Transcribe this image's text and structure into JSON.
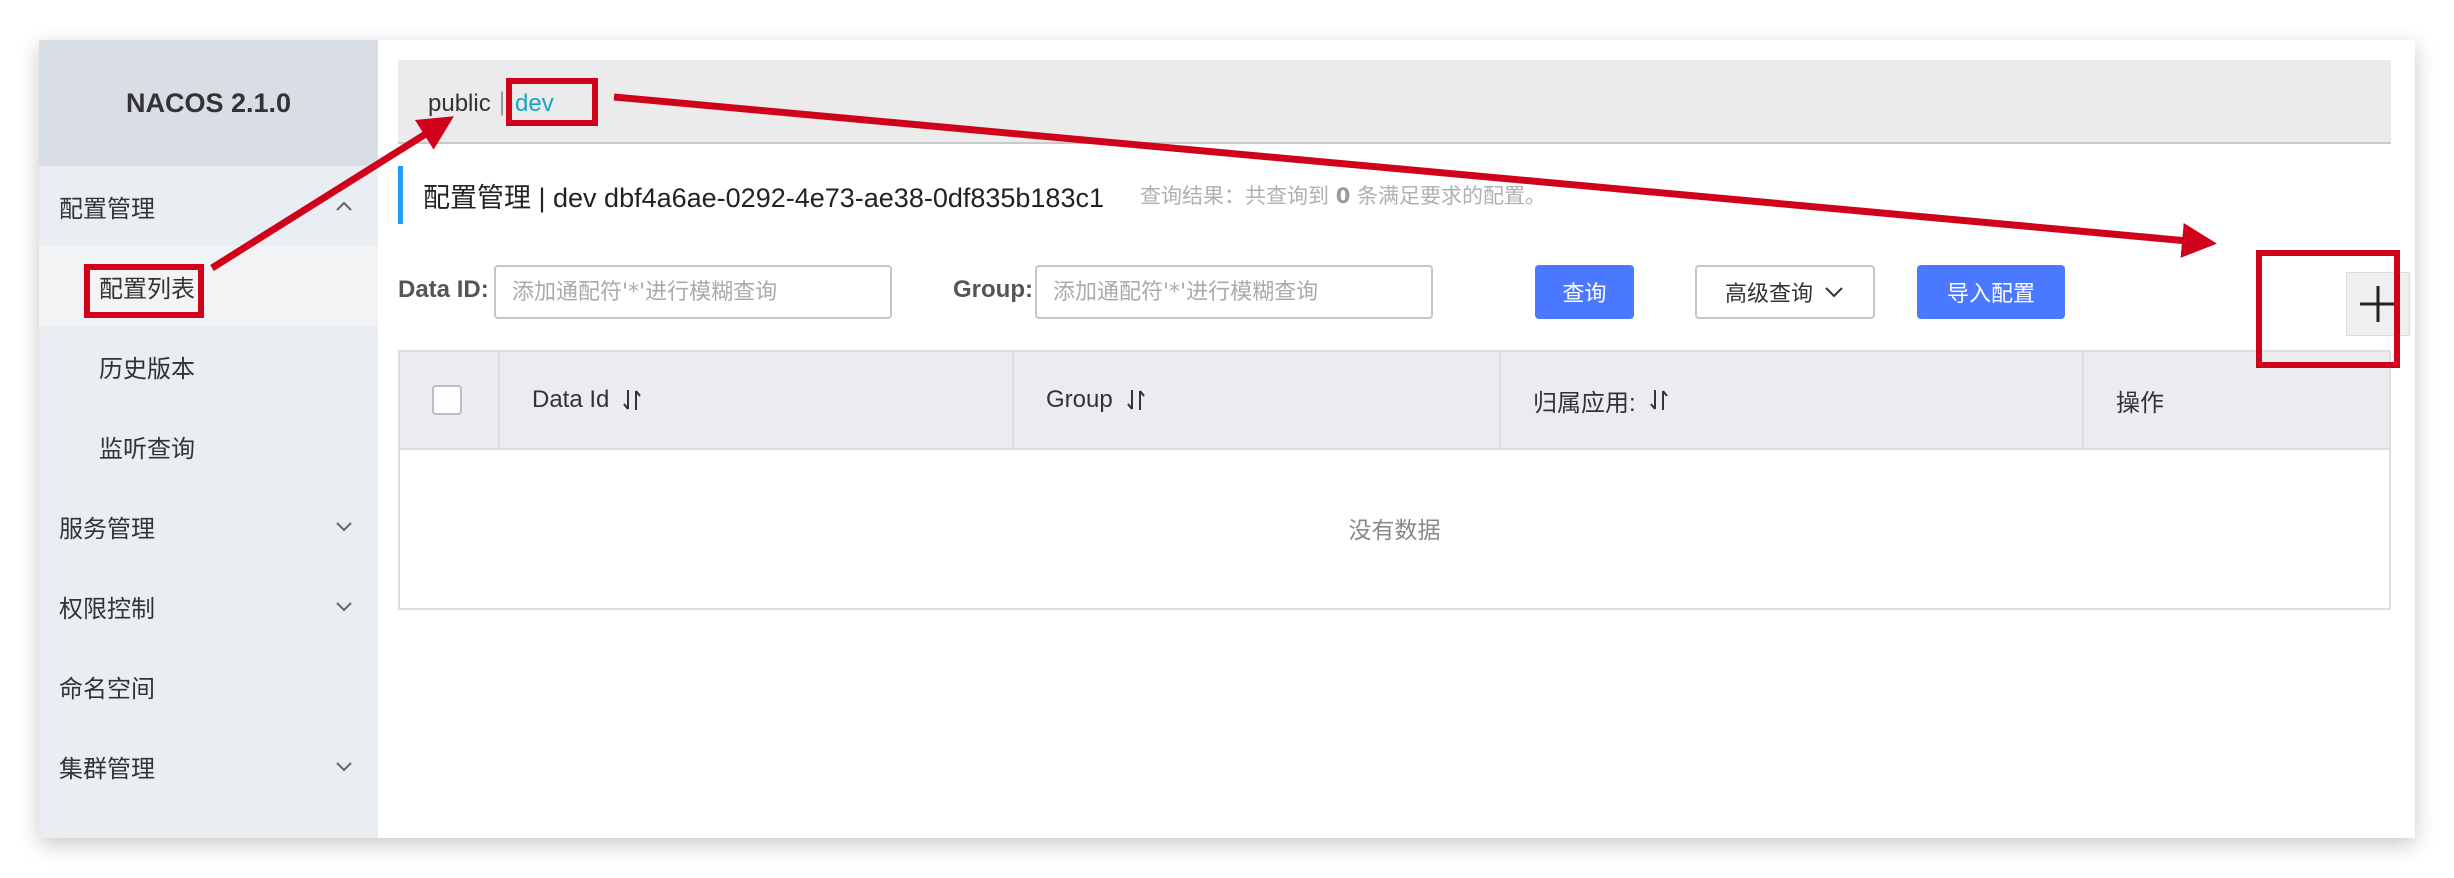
{
  "brand": "NACOS 2.1.0",
  "sidebar": {
    "config_group": "配置管理",
    "config_items": [
      "配置列表",
      "历史版本",
      "监听查询"
    ],
    "service_group": "服务管理",
    "permission_group": "权限控制",
    "namespace": "命名空间",
    "cluster_group": "集群管理"
  },
  "namespace_bar": {
    "public": "public",
    "separator": "|",
    "dev": "dev"
  },
  "page": {
    "title": "配置管理  |  dev  dbf4a6ae-0292-4e73-ae38-0df835b183c1",
    "result_prefix": "查询结果：共查询到",
    "result_count": "0",
    "result_suffix": "条满足要求的配置。"
  },
  "search": {
    "dataid_label": "Data ID:",
    "dataid_placeholder": "添加通配符'*'进行模糊查询",
    "group_label": "Group:",
    "group_placeholder": "添加通配符'*'进行模糊查询",
    "query_button": "查询",
    "advanced_button": "高级查询",
    "import_button": "导入配置"
  },
  "table": {
    "columns": [
      "Data Id",
      "Group",
      "归属应用:",
      "操作"
    ],
    "empty_text": "没有数据"
  },
  "colors": {
    "accent": "#4a78ff",
    "annotation": "#d0021b",
    "link": "#1aa3c4"
  }
}
